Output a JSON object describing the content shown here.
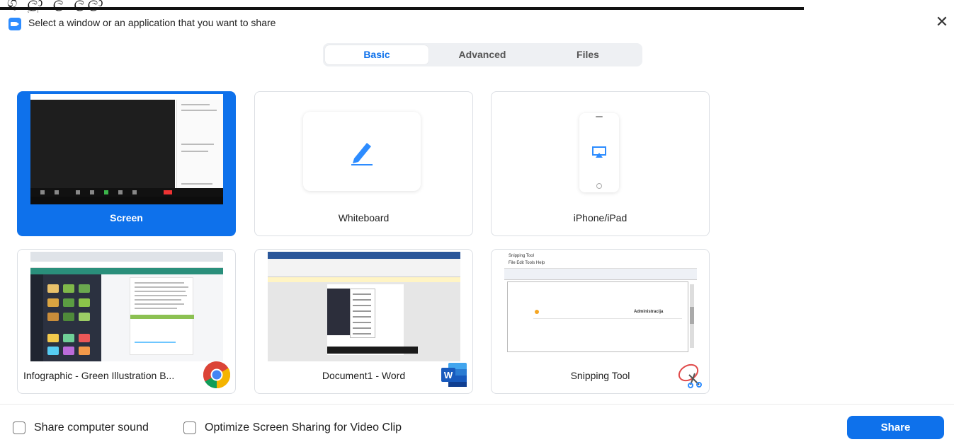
{
  "window": {
    "title": "Select a window or an application that you want to share",
    "close_symbol": "✕",
    "top_strip_glyphs": "ගු ලුා ල ලලා"
  },
  "tabs": [
    {
      "label": "Basic",
      "active": true
    },
    {
      "label": "Advanced",
      "active": false
    },
    {
      "label": "Files",
      "active": false
    }
  ],
  "cards": [
    {
      "label": "Screen",
      "selected": true,
      "icon": "screen-preview"
    },
    {
      "label": "Whiteboard",
      "selected": false,
      "icon": "pencil-icon"
    },
    {
      "label": "iPhone/iPad",
      "selected": false,
      "icon": "airplay-icon"
    },
    {
      "label": "Infographic - Green Illustration B...",
      "selected": false,
      "icon": "chrome-icon"
    },
    {
      "label": "Document1 - Word",
      "selected": false,
      "icon": "word-icon"
    },
    {
      "label": "Snipping Tool",
      "selected": false,
      "icon": "scissors-icon"
    }
  ],
  "thumbnails": {
    "word_menu_title": "File Edit Tools Help",
    "snipping_row_text": "Administracija",
    "snipping_title": "Snipping Tool"
  },
  "footer": {
    "share_sound_label": "Share computer sound",
    "share_sound_checked": false,
    "optimize_label": "Optimize Screen Sharing for Video Clip",
    "optimize_checked": false,
    "share_button": "Share"
  },
  "colors": {
    "accent": "#0e71eb",
    "zoom_blue": "#2d8cff",
    "word_blue": "#2b579a"
  }
}
